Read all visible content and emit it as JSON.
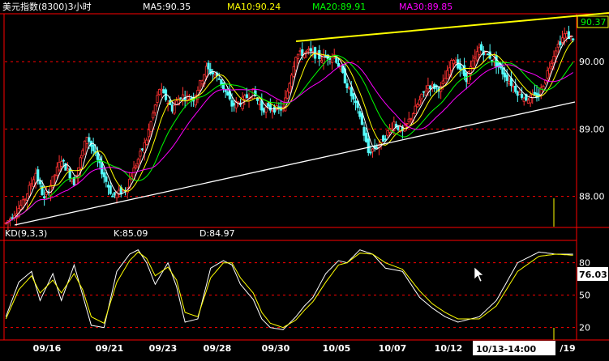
{
  "header": {
    "title": "美元指数(8300)3小时",
    "ma5": "MA5:90.35",
    "ma10": "MA10:90.24",
    "ma20": "MA20:89.91",
    "ma30": "MA30:89.85"
  },
  "kd_header": {
    "label": "KD(9,3,3)",
    "k": "K:85.09",
    "d": "D:84.97"
  },
  "price_badge": "90.37",
  "kd_badge": "76.03",
  "cursor_label": "10/13-14:00",
  "colors": {
    "up": "#ff3232",
    "down": "#54ffff",
    "ma5": "#ffffff",
    "ma10": "#ffff00",
    "ma20": "#00ff00",
    "ma30": "#ff00ff",
    "axis": "#ff0000",
    "trend_upper": "#ffff00",
    "trend_lower": "#ffffff"
  },
  "chart_data": {
    "type": "candlestick",
    "price_axis": {
      "ticks": [
        88.0,
        89.0,
        90.0
      ],
      "range": [
        87.55,
        90.7
      ]
    },
    "kd_axis": {
      "ticks": [
        20,
        50,
        80
      ],
      "range": [
        10,
        100
      ]
    },
    "x_labels": [
      "09/16",
      "09/21",
      "09/23",
      "09/28",
      "09/30",
      "10/05",
      "10/07",
      "10/12",
      "/19"
    ],
    "price_path": [
      [
        0,
        87.6
      ],
      [
        8,
        87.9
      ],
      [
        14,
        88.35
      ],
      [
        18,
        87.95
      ],
      [
        26,
        88.55
      ],
      [
        32,
        88.2
      ],
      [
        38,
        88.9
      ],
      [
        44,
        88.45
      ],
      [
        50,
        88.0
      ],
      [
        56,
        88.1
      ],
      [
        62,
        88.55
      ],
      [
        66,
        88.85
      ],
      [
        72,
        89.6
      ],
      [
        78,
        89.3
      ],
      [
        82,
        89.5
      ],
      [
        88,
        89.45
      ],
      [
        94,
        89.9
      ],
      [
        100,
        89.75
      ],
      [
        106,
        89.35
      ],
      [
        110,
        89.4
      ],
      [
        116,
        89.55
      ],
      [
        120,
        89.3
      ],
      [
        130,
        89.3
      ],
      [
        136,
        90.1
      ],
      [
        142,
        90.15
      ],
      [
        148,
        90.05
      ],
      [
        154,
        90.1
      ],
      [
        160,
        89.65
      ],
      [
        166,
        89.2
      ],
      [
        170,
        88.65
      ],
      [
        176,
        88.8
      ],
      [
        182,
        89.1
      ],
      [
        186,
        88.95
      ],
      [
        192,
        89.3
      ],
      [
        198,
        89.65
      ],
      [
        204,
        89.6
      ],
      [
        210,
        90.05
      ],
      [
        216,
        89.75
      ],
      [
        222,
        90.2
      ],
      [
        228,
        90.05
      ],
      [
        234,
        89.8
      ],
      [
        240,
        89.55
      ],
      [
        244,
        89.45
      ],
      [
        250,
        89.5
      ],
      [
        254,
        89.85
      ],
      [
        258,
        90.2
      ],
      [
        262,
        90.4
      ],
      [
        266,
        90.35
      ]
    ],
    "kd_k": [
      [
        0,
        30
      ],
      [
        6,
        62
      ],
      [
        12,
        72
      ],
      [
        16,
        45
      ],
      [
        22,
        70
      ],
      [
        26,
        45
      ],
      [
        32,
        78
      ],
      [
        36,
        50
      ],
      [
        40,
        22
      ],
      [
        46,
        20
      ],
      [
        52,
        72
      ],
      [
        58,
        88
      ],
      [
        62,
        92
      ],
      [
        66,
        80
      ],
      [
        70,
        60
      ],
      [
        76,
        80
      ],
      [
        80,
        58
      ],
      [
        84,
        25
      ],
      [
        90,
        28
      ],
      [
        96,
        75
      ],
      [
        102,
        82
      ],
      [
        106,
        78
      ],
      [
        110,
        60
      ],
      [
        116,
        46
      ],
      [
        120,
        28
      ],
      [
        124,
        20
      ],
      [
        130,
        18
      ],
      [
        136,
        30
      ],
      [
        140,
        40
      ],
      [
        144,
        48
      ],
      [
        150,
        70
      ],
      [
        156,
        82
      ],
      [
        160,
        80
      ],
      [
        166,
        92
      ],
      [
        172,
        88
      ],
      [
        178,
        75
      ],
      [
        186,
        72
      ],
      [
        194,
        48
      ],
      [
        200,
        38
      ],
      [
        206,
        30
      ],
      [
        212,
        25
      ],
      [
        222,
        30
      ],
      [
        230,
        45
      ],
      [
        240,
        80
      ],
      [
        250,
        90
      ],
      [
        258,
        88
      ],
      [
        266,
        88
      ]
    ],
    "kd_d": [
      [
        0,
        28
      ],
      [
        6,
        55
      ],
      [
        12,
        68
      ],
      [
        16,
        52
      ],
      [
        22,
        64
      ],
      [
        26,
        52
      ],
      [
        32,
        70
      ],
      [
        36,
        55
      ],
      [
        40,
        30
      ],
      [
        46,
        24
      ],
      [
        52,
        62
      ],
      [
        58,
        82
      ],
      [
        62,
        90
      ],
      [
        66,
        84
      ],
      [
        70,
        68
      ],
      [
        76,
        76
      ],
      [
        80,
        64
      ],
      [
        84,
        34
      ],
      [
        90,
        30
      ],
      [
        96,
        66
      ],
      [
        102,
        80
      ],
      [
        106,
        80
      ],
      [
        110,
        66
      ],
      [
        116,
        52
      ],
      [
        120,
        34
      ],
      [
        124,
        24
      ],
      [
        130,
        20
      ],
      [
        136,
        27
      ],
      [
        140,
        36
      ],
      [
        144,
        44
      ],
      [
        150,
        62
      ],
      [
        156,
        78
      ],
      [
        160,
        80
      ],
      [
        166,
        89
      ],
      [
        172,
        88
      ],
      [
        178,
        80
      ],
      [
        186,
        74
      ],
      [
        194,
        54
      ],
      [
        200,
        42
      ],
      [
        206,
        34
      ],
      [
        212,
        28
      ],
      [
        222,
        28
      ],
      [
        230,
        40
      ],
      [
        240,
        72
      ],
      [
        250,
        86
      ],
      [
        258,
        88
      ],
      [
        266,
        87
      ]
    ]
  }
}
